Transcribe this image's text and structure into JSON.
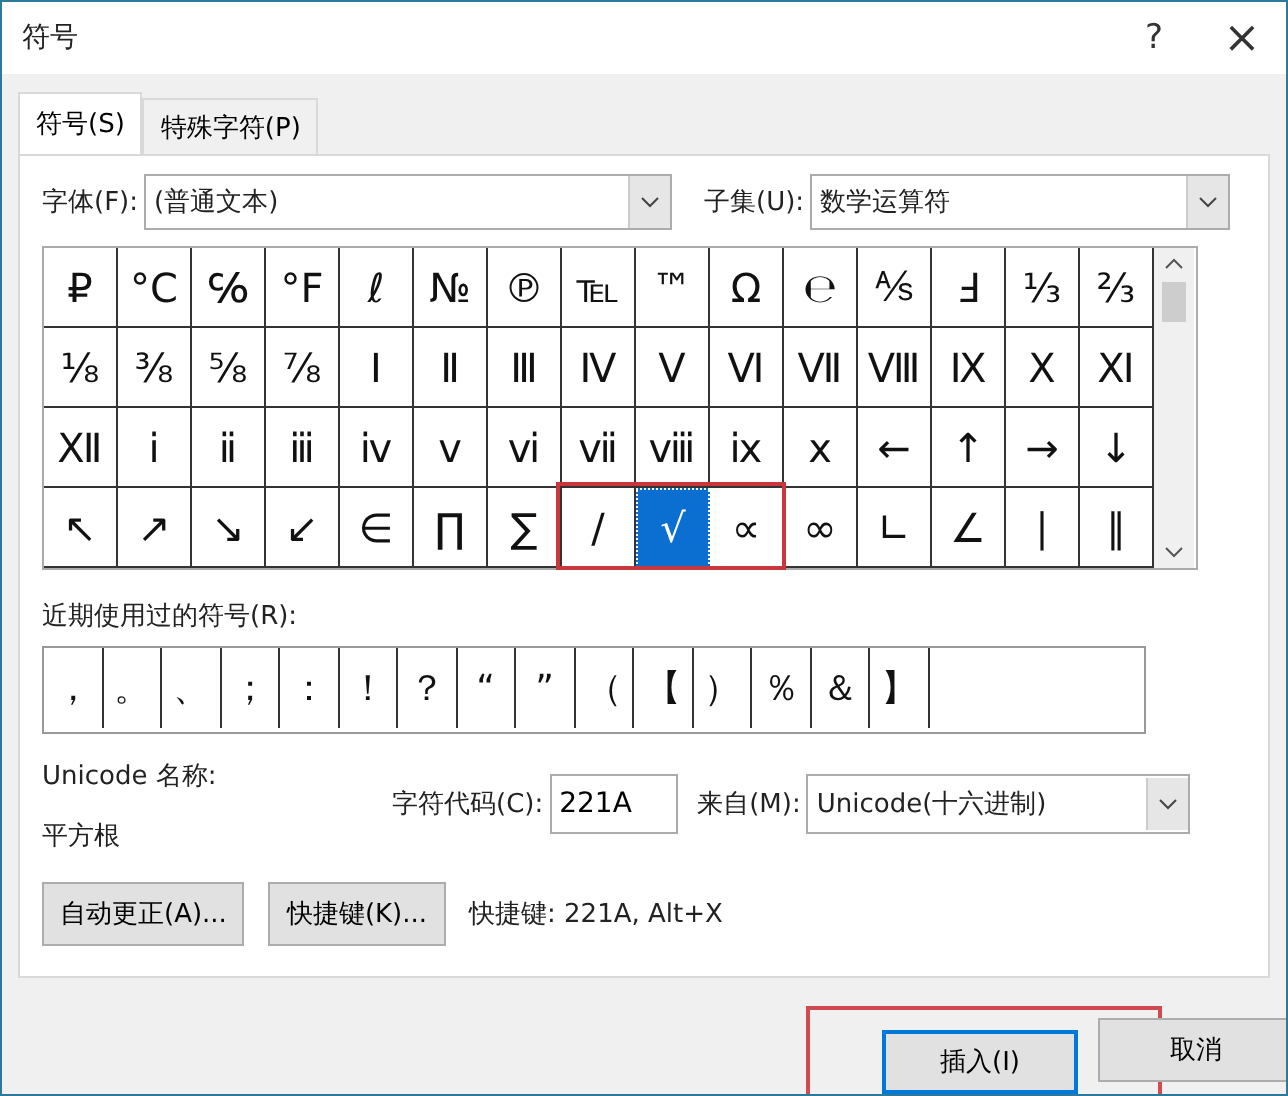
{
  "window": {
    "title": "符号",
    "help": "?",
    "close": "×"
  },
  "tabs": [
    {
      "label": "符号(S)",
      "selected": true
    },
    {
      "label": "特殊字符(P)",
      "selected": false
    }
  ],
  "font": {
    "label": "字体(F):",
    "value": "(普通文本)"
  },
  "subset": {
    "label": "子集(U):",
    "value": "数学运算符"
  },
  "symbols": [
    [
      {
        "char": "₽",
        "selected": false,
        "annotated": false
      },
      {
        "char": "°C",
        "selected": false,
        "annotated": false
      },
      {
        "char": "℅",
        "selected": false,
        "annotated": false
      },
      {
        "char": "°F",
        "selected": false,
        "annotated": false
      },
      {
        "char": "ℓ",
        "selected": false,
        "annotated": false
      },
      {
        "char": "№",
        "selected": false,
        "annotated": false
      },
      {
        "char": "℗",
        "selected": false,
        "annotated": false
      },
      {
        "char": "℡",
        "selected": false,
        "annotated": false
      },
      {
        "char": "™",
        "selected": false,
        "annotated": false
      },
      {
        "char": "Ω",
        "selected": false,
        "annotated": false
      },
      {
        "char": "℮",
        "selected": false,
        "annotated": false
      },
      {
        "char": "⅍",
        "selected": false,
        "annotated": false
      },
      {
        "char": "Ⅎ",
        "selected": false,
        "annotated": false
      },
      {
        "char": "⅓",
        "selected": false,
        "annotated": false
      },
      {
        "char": "⅔",
        "selected": false,
        "annotated": false
      }
    ],
    [
      {
        "char": "⅛",
        "selected": false,
        "annotated": false
      },
      {
        "char": "⅜",
        "selected": false,
        "annotated": false
      },
      {
        "char": "⅝",
        "selected": false,
        "annotated": false
      },
      {
        "char": "⅞",
        "selected": false,
        "annotated": false
      },
      {
        "char": "Ⅰ",
        "selected": false,
        "annotated": false
      },
      {
        "char": "Ⅱ",
        "selected": false,
        "annotated": false
      },
      {
        "char": "Ⅲ",
        "selected": false,
        "annotated": false
      },
      {
        "char": "Ⅳ",
        "selected": false,
        "annotated": false
      },
      {
        "char": "Ⅴ",
        "selected": false,
        "annotated": false
      },
      {
        "char": "Ⅵ",
        "selected": false,
        "annotated": false
      },
      {
        "char": "Ⅶ",
        "selected": false,
        "annotated": false
      },
      {
        "char": "Ⅷ",
        "selected": false,
        "annotated": false
      },
      {
        "char": "Ⅸ",
        "selected": false,
        "annotated": false
      },
      {
        "char": "Ⅹ",
        "selected": false,
        "annotated": false
      },
      {
        "char": "Ⅺ",
        "selected": false,
        "annotated": false
      }
    ],
    [
      {
        "char": "Ⅻ",
        "selected": false,
        "annotated": false
      },
      {
        "char": "ⅰ",
        "selected": false,
        "annotated": false
      },
      {
        "char": "ⅱ",
        "selected": false,
        "annotated": false
      },
      {
        "char": "ⅲ",
        "selected": false,
        "annotated": false
      },
      {
        "char": "ⅳ",
        "selected": false,
        "annotated": false
      },
      {
        "char": "ⅴ",
        "selected": false,
        "annotated": false
      },
      {
        "char": "ⅵ",
        "selected": false,
        "annotated": false
      },
      {
        "char": "ⅶ",
        "selected": false,
        "annotated": false
      },
      {
        "char": "ⅷ",
        "selected": false,
        "annotated": false
      },
      {
        "char": "ⅸ",
        "selected": false,
        "annotated": false
      },
      {
        "char": "ⅹ",
        "selected": false,
        "annotated": false
      },
      {
        "char": "←",
        "selected": false,
        "annotated": false
      },
      {
        "char": "↑",
        "selected": false,
        "annotated": false
      },
      {
        "char": "→",
        "selected": false,
        "annotated": false
      },
      {
        "char": "↓",
        "selected": false,
        "annotated": false
      }
    ],
    [
      {
        "char": "↖",
        "selected": false,
        "annotated": false
      },
      {
        "char": "↗",
        "selected": false,
        "annotated": false
      },
      {
        "char": "↘",
        "selected": false,
        "annotated": false
      },
      {
        "char": "↙",
        "selected": false,
        "annotated": false
      },
      {
        "char": "∈",
        "selected": false,
        "annotated": false
      },
      {
        "char": "∏",
        "selected": false,
        "annotated": false
      },
      {
        "char": "∑",
        "selected": false,
        "annotated": false
      },
      {
        "char": "∕",
        "selected": false,
        "annotated": true
      },
      {
        "char": "√",
        "selected": true,
        "annotated": true
      },
      {
        "char": "∝",
        "selected": false,
        "annotated": true
      },
      {
        "char": "∞",
        "selected": false,
        "annotated": false
      },
      {
        "char": "∟",
        "selected": false,
        "annotated": false
      },
      {
        "char": "∠",
        "selected": false,
        "annotated": false
      },
      {
        "char": "∣",
        "selected": false,
        "annotated": false
      },
      {
        "char": "∥",
        "selected": false,
        "annotated": false
      }
    ]
  ],
  "recent": {
    "label": "近期使用过的符号(R):",
    "symbols": [
      "，",
      "。",
      "、",
      "；",
      "：",
      "！",
      "？",
      "“",
      "”",
      "（",
      "【",
      "）",
      "％",
      "＆",
      "】"
    ]
  },
  "unicode_name": {
    "label": "Unicode 名称:",
    "value": "平方根"
  },
  "char_code": {
    "label": "字符代码(C):",
    "value": "221A"
  },
  "from": {
    "label": "来自(M):",
    "value": "Unicode(十六进制)"
  },
  "buttons": [
    {
      "label": "自动更正(A)..."
    },
    {
      "label": "快捷键(K)..."
    }
  ],
  "shortcut_text": "快捷键: 221A, Alt+X",
  "footer_buttons": [
    {
      "label": "插入(I)",
      "kind": "primary",
      "annotated": true
    },
    {
      "label": "取消",
      "kind": "normal",
      "annotated": false
    }
  ]
}
